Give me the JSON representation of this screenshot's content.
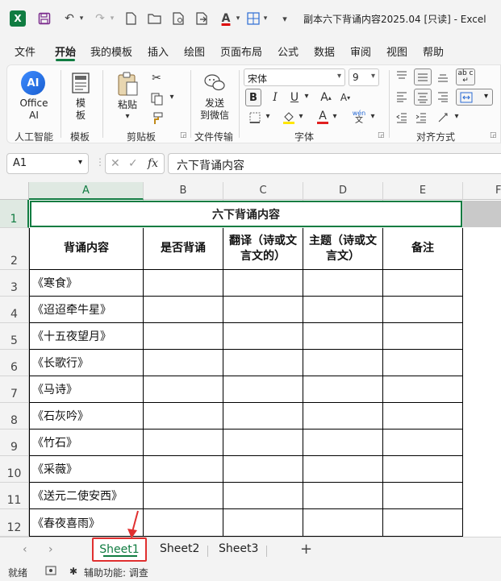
{
  "window": {
    "app_letter": "X",
    "title": "副本六下背诵内容2025.04 [只读] - Excel",
    "colors": {
      "accent": "#107c41",
      "annotation": "#e03030"
    }
  },
  "menu": {
    "tabs": [
      "文件",
      "开始",
      "我的模板",
      "插入",
      "绘图",
      "页面布局",
      "公式",
      "数据",
      "审阅",
      "视图",
      "帮助"
    ],
    "active": "开始"
  },
  "ribbon": {
    "ai": {
      "icon_text": "AI",
      "label_line1": "Office",
      "label_line2": "AI",
      "group": "人工智能"
    },
    "template": {
      "label_line1": "模",
      "label_line2": "板",
      "group": "模板"
    },
    "clipboard": {
      "paste_label": "粘贴",
      "group": "剪贴板"
    },
    "file_transfer": {
      "label_line1": "发送",
      "label_line2": "到微信",
      "group": "文件传输"
    },
    "font": {
      "name": "宋体",
      "size": "9",
      "bold": "B",
      "italic": "I",
      "underline": "U",
      "font_color_letter": "A",
      "wen": "wén",
      "wen_char": "文",
      "group": "字体"
    },
    "alignment": {
      "group": "对齐方式",
      "wrap": "ab c"
    }
  },
  "formula_bar": {
    "name_box": "A1",
    "fx": "fx",
    "content": "六下背诵内容"
  },
  "sheet": {
    "columns": [
      "A",
      "B",
      "C",
      "D",
      "E",
      "F"
    ],
    "title": "六下背诵内容",
    "headers": [
      "背诵内容",
      "是否背诵",
      "翻译（诗或文言文的）",
      "主题（诗或文言文）",
      "备注"
    ],
    "row_numbers": [
      "1",
      "2",
      "3",
      "4",
      "5",
      "6",
      "7",
      "8",
      "9",
      "10",
      "11",
      "12"
    ],
    "items": [
      "《寒食》",
      "《迢迢牵牛星》",
      "《十五夜望月》",
      "《长歌行》",
      "《马诗》",
      "《石灰吟》",
      "《竹石》",
      "《采薇》",
      "《送元二使安西》",
      "《春夜喜雨》"
    ]
  },
  "sheet_tabs": {
    "tabs": [
      "Sheet1",
      "Sheet2",
      "Sheet3"
    ],
    "active": "Sheet1",
    "add": "+"
  },
  "status": {
    "ready": "就绪",
    "accessibility": "辅助功能: 调查"
  }
}
